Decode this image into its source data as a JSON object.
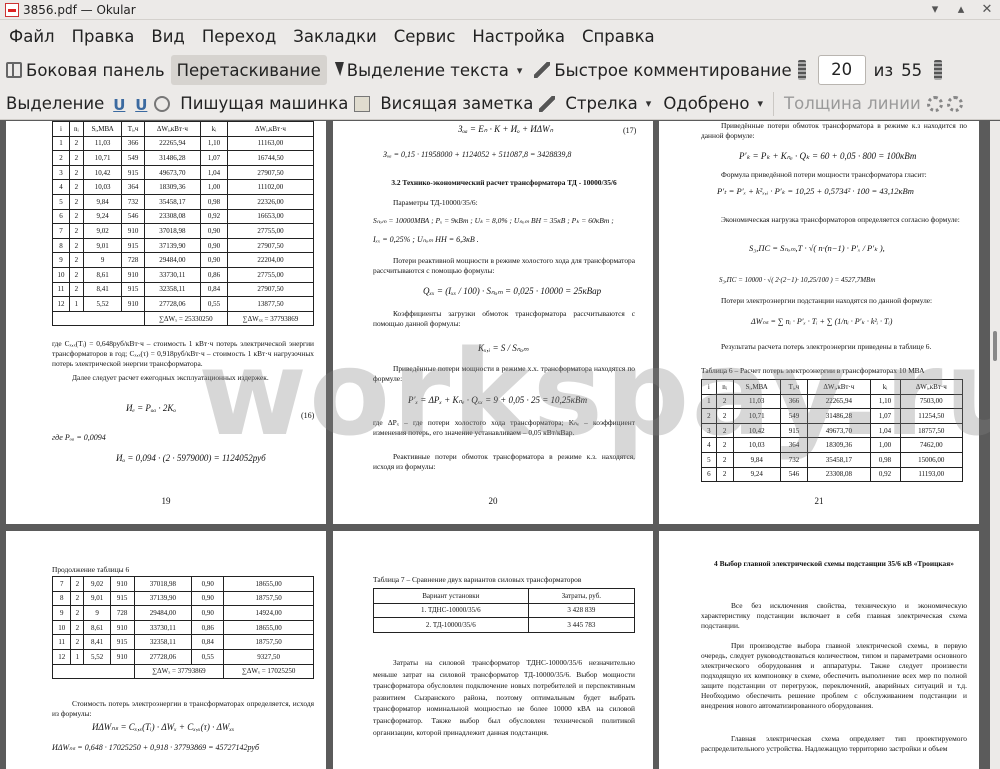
{
  "window": {
    "title": "3856.pdf — Okular",
    "min": "▾",
    "max": "▴",
    "close": "✕"
  },
  "menu": [
    "Файл",
    "Правка",
    "Вид",
    "Переход",
    "Закладки",
    "Сервис",
    "Настройка",
    "Справка"
  ],
  "toolbar": {
    "sidebar": "Боковая панель",
    "drag": "Перетаскивание",
    "select": "Выделение текста",
    "quick": "Быстрое комментирование",
    "page": "20",
    "of": "из",
    "total": "55"
  },
  "annot": {
    "highlight": "Выделение",
    "typewriter": "Пишущая машинка",
    "note": "Висящая заметка",
    "arrow": "Стрелка",
    "approved": "Одобрено",
    "linewidth": "Толщина линии"
  },
  "watermark": "workspay.ru",
  "pages": {
    "p19": {
      "num": "19",
      "header": [
        "i",
        "Sᵢ,МВА",
        "Tᵢ,ч",
        "ΔWᵢ,кВт·ч",
        "kᵢ",
        "ΔWᵢ,кВт·ч"
      ],
      "rows": [
        [
          "1",
          "2",
          "11,03",
          "366",
          "22265,94",
          "1,10",
          "11163,00"
        ],
        [
          "2",
          "2",
          "10,71",
          "549",
          "31486,28",
          "1,07",
          "16744,50"
        ],
        [
          "3",
          "2",
          "10,42",
          "915",
          "49673,70",
          "1,04",
          "27907,50"
        ],
        [
          "4",
          "2",
          "10,03",
          "364",
          "18309,36",
          "1,00",
          "11102,00"
        ],
        [
          "5",
          "2",
          "9,84",
          "732",
          "35458,17",
          "0,98",
          "22326,00"
        ],
        [
          "6",
          "2",
          "9,24",
          "546",
          "23308,08",
          "0,92",
          "16653,00"
        ],
        [
          "7",
          "2",
          "9,02",
          "910",
          "37018,98",
          "0,90",
          "27755,00"
        ],
        [
          "8",
          "2",
          "9,01",
          "915",
          "37139,90",
          "0,90",
          "27907,50"
        ],
        [
          "9",
          "2",
          "9",
          "728",
          "29484,00",
          "0,90",
          "22204,00"
        ],
        [
          "10",
          "2",
          "8,61",
          "910",
          "33730,11",
          "0,86",
          "27755,00"
        ],
        [
          "11",
          "2",
          "8,41",
          "915",
          "32358,11",
          "0,84",
          "27907,50"
        ],
        [
          "12",
          "1",
          "5,52",
          "910",
          "27728,06",
          "0,55",
          "13877,50"
        ]
      ],
      "sum1": "∑ΔWₓ = 25330250",
      "sum2": "∑ΔWₓₓ = 37793869",
      "t1": "где  Cₓ,ₓ(Tᵢ) = 0,648руб/кВт·ч – стоимость 1 кВт·ч потерь электрической энергии трансформаторов в год; Cₓ,ₓ(τ) = 0,918руб/кВт·ч – стоимость 1 кВт·ч нагрузочных потерь электрической энергии трансформатора.",
      "t2": "Далее следует расчет ежегодных эксплуатационных издержек.",
      "f1": "Иₑ = Рₒₐ · 2Кₒ",
      "n1": "(16)",
      "f2": "где  Рₒₐ = 0,0094",
      "f3": "Иₒ = 0,094 · (2 · 5979000) = 1124052руб"
    },
    "p20": {
      "num": "20",
      "f1": "Зₒₐ = Eₙ · K + Иₒ + ИΔWₙ",
      "n1": "(17)",
      "f2": "Зₒₐ = 0,15 · 11958000 + 1124052 + 511087,8 = 3428839,8",
      "h1": "3.2 Технико-экономический расчет трансформатора ТД - 10000/35/6",
      "t1": "Параметры ТД-10000/35/6:",
      "f3": "Sₙₒₘ = 10000МВА ;  Pₓ = 9кВт ;  Uₖ = 8,0% ;  Uₙₒₘ ВН = 35кВ ;  Pₖ = 60кВт ;",
      "f4": "Iₓₓ = 0,25% ;  Uₙₒₘ НН = 6,3кВ .",
      "t2": "Потери реактивной мощности в режиме холостого хода для трансформатора рассчитываются с помощью формулы:",
      "f5": "Qₓₓ = (Iₓₓ / 100) · Sₙₒₘ = 0,025 · 10000 = 25кВар",
      "t3": "Коэффициенты загрузки обмоток трансформатора рассчитываются с помощью данной формулы:",
      "f6": "Kₓ,ᵢ = S / Sₙₒₘ",
      "t4": "Приведённые потери мощности в режиме х.х. трансформатора находятся по формуле:",
      "f7": "P′ₓ = ΔPₓ + Kₙₑ · Qₓₓ = 9 + 0,05 · 25 = 10,25кВт",
      "t5": "где ΔPₓ – где потери холостого хода трансформатора; Kₙₑ – коэффициент изменения потерь, его значение устанавливаем – 0,05 кВт/кВар.",
      "t6": "Реактивные потери обмоток трансформатора в режиме к.з. находятся, исходя из формулы:"
    },
    "p21": {
      "num": "21",
      "t1": "Приведённые потери обмоток трансформатора в режиме к.з находится по данной формуле:",
      "f1": "P′ₖ = Pₖ + Kₙₑ · Qₖ = 60 + 0,05 · 800 = 100кВт",
      "t2": "Формула приведённой потери мощности трансформатора гласит:",
      "f2": "P′ₜ = P′ₓ + k²ₓ,ᵢ · P′ₖ = 10,25 + 0,5734² · 100 = 43,12кВт",
      "t3": "Экономическая нагрузка трансформаторов определяется согласно формуле:",
      "f3": "S₃,ПС = Sₙₒₘ,Т · √( n·(n−1) · P′ₓ / P′ₖ ),",
      "f4": "S₃,ПС = 10000 · √( 2·(2−1)· 10,25/100 ) = 4527,7МВт",
      "t4": "Потери электроэнергии подстанции находятся по данной формуле:",
      "f5": "ΔWₙₛ = ∑ nᵢ · P′ₓ · Tᵢ + ∑ (1/nᵢ · P′ₖ · k²ᵢ · Tᵢ)",
      "t5": "Результаты расчета потерь электроэнергии приведены в таблице 6.",
      "cap": "Таблица 6 – Расчет потерь электроэнергии в трансформаторах 10 МВА",
      "header": [
        "i",
        "Sᵢ,МВА",
        "Tᵢ,ч",
        "ΔWᵢ,кВт·ч",
        "kᵢ",
        "ΔWᵢ,кВт·ч"
      ],
      "rows": [
        [
          "1",
          "2",
          "11,03",
          "366",
          "22265,94",
          "1,10",
          "7503,00"
        ],
        [
          "2",
          "2",
          "10,71",
          "549",
          "31486,28",
          "1,07",
          "11254,50"
        ],
        [
          "3",
          "2",
          "10,42",
          "915",
          "49673,70",
          "1,04",
          "18757,50"
        ],
        [
          "4",
          "2",
          "10,03",
          "364",
          "18309,36",
          "1,00",
          "7462,00"
        ],
        [
          "5",
          "2",
          "9,84",
          "732",
          "35458,17",
          "0,98",
          "15006,00"
        ],
        [
          "6",
          "2",
          "9,24",
          "546",
          "23308,08",
          "0,92",
          "11193,00"
        ]
      ]
    },
    "p22": {
      "cap": "Продолжение таблицы 6",
      "rows": [
        [
          "7",
          "2",
          "9,02",
          "910",
          "37018,98",
          "0,90",
          "18655,00"
        ],
        [
          "8",
          "2",
          "9,01",
          "915",
          "37139,90",
          "0,90",
          "18757,50"
        ],
        [
          "9",
          "2",
          "9",
          "728",
          "29484,00",
          "0,90",
          "14924,00"
        ],
        [
          "10",
          "2",
          "8,61",
          "910",
          "33730,11",
          "0,86",
          "18655,00"
        ],
        [
          "11",
          "2",
          "8,41",
          "915",
          "32358,11",
          "0,84",
          "18757,50"
        ],
        [
          "12",
          "1",
          "5,52",
          "910",
          "27728,06",
          "0,55",
          "9327,50"
        ]
      ],
      "sum1": "∑ΔWₓ = 37793869",
      "sum2": "∑ΔWₓ = 17025250",
      "t1": "Стоимость потерь электроэнергии в трансформаторах определяется, исходя из формулы:",
      "f1": "ИΔWₙₛ = Cₓ,ₓ(Tᵢ) · ΔWₓ + Cₓ,ₓ(τ) · ΔWₓₓ",
      "f2": "ИΔWₙₛ = 0,648 · 17025250 + 0,918 · 37793869 = 45727142руб"
    },
    "p23": {
      "cap": "Таблица 7 – Сравнение двух вариантов силовых трансформаторов",
      "h1": "Вариант установки",
      "h2": "Затраты, руб.",
      "rows": [
        [
          "1. ТДНС-10000/35/6",
          "3 428 839"
        ],
        [
          "2. ТД-10000/35/6",
          "3 445 783"
        ]
      ],
      "t1": "Затраты на силовой трансформатор ТДНС-10000/35/6 незначительно меньше затрат на силовой трансформатор ТД-10000/35/6. Выбор мощности трансформатора обусловлен подключение новых потребителей и перспективным развитием Сызранского района, поэтому оптимальным будет выбрать трансформатор номинальной мощностью не более 10000 кВА на силовой трансформатор. Также выбор был обусловлен технической политикой организации, которой принадлежит данная подстанция."
    },
    "p24": {
      "h1": "4 Выбор главной электрической схемы подстанции 35/6 кВ «Троицкая»",
      "t1": "Все без исключения свойства, техническую и экономическую характеристику подстанции включает в себя главная электрическая схема подстанции.",
      "t2": "При производстве выбора главной электрической схемы, в первую очередь, следует руководствоваться количеством, типом и параметрами основного электрического оборудования и аппаратуры. Также следует произвести подходящую их компоновку в схеме, обеспечить выполнение всех мер по полной защите подстанции от перегрузок, переключений, аварийных ситуаций и т.д. Необходимо обеспечить решение проблем с обслуживанием подстанции и внедрения нового автоматизированного оборудования.",
      "t3": "Главная электрическая схема определяет тип проектируемого распределительного устройства. Надлежащую территорию застройки и объем"
    }
  }
}
